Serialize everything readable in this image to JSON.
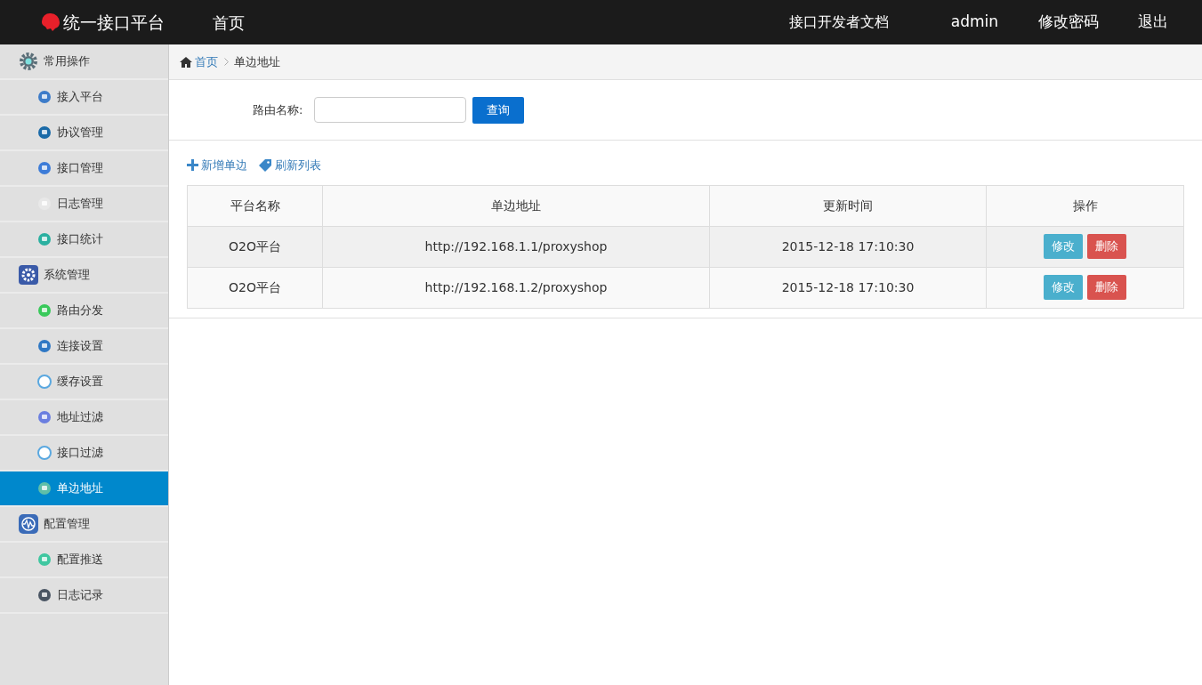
{
  "navbar": {
    "brand": "统一接口平台",
    "home": "首页",
    "links": [
      "接口开发者文档",
      "admin",
      "修改密码",
      "退出"
    ]
  },
  "sidebar": {
    "groups": [
      {
        "label": "常用操作",
        "children": [
          {
            "label": "接入平台",
            "selected": false
          },
          {
            "label": "协议管理",
            "selected": false
          },
          {
            "label": "接口管理",
            "selected": false
          },
          {
            "label": "日志管理",
            "selected": false
          },
          {
            "label": "接口统计",
            "selected": false
          }
        ]
      },
      {
        "label": "系统管理",
        "children": [
          {
            "label": "路由分发",
            "selected": false
          },
          {
            "label": "连接设置",
            "selected": false
          },
          {
            "label": "缓存设置",
            "selected": false
          },
          {
            "label": "地址过滤",
            "selected": false
          },
          {
            "label": "接口过滤",
            "selected": false
          },
          {
            "label": "单边地址",
            "selected": true
          }
        ]
      },
      {
        "label": "配置管理",
        "children": [
          {
            "label": "配置推送",
            "selected": false
          },
          {
            "label": "日志记录",
            "selected": false
          }
        ]
      }
    ]
  },
  "breadcrumb": {
    "home": "首页",
    "current": "单边地址"
  },
  "search": {
    "label": "路由名称:",
    "button": "查询"
  },
  "toolbar": {
    "add": "新增单边",
    "refresh": "刷新列表"
  },
  "table": {
    "columns": [
      "平台名称",
      "单边地址",
      "更新时间",
      "操作"
    ],
    "rows": [
      {
        "platform": "O2O平台",
        "address": "http://192.168.1.1/proxyshop",
        "updated": "2015-12-18 17:10:30",
        "edit": "修改",
        "delete": "删除"
      },
      {
        "platform": "O2O平台",
        "address": "http://192.168.1.2/proxyshop",
        "updated": "2015-12-18 17:10:30",
        "edit": "修改",
        "delete": "删除"
      }
    ]
  }
}
